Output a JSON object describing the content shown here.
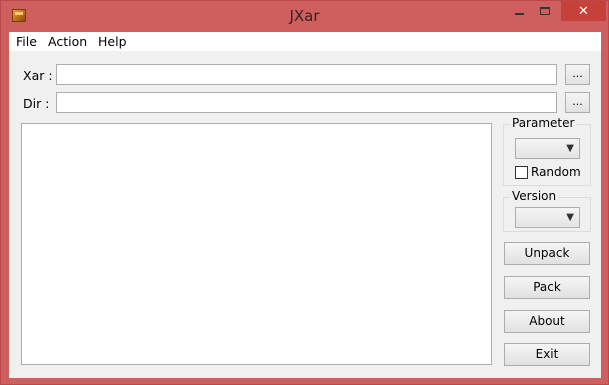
{
  "window": {
    "title": "JXar",
    "close_glyph": "✕"
  },
  "menu": {
    "file": "File",
    "action": "Action",
    "help": "Help"
  },
  "fields": {
    "xar_label": "Xar :",
    "dir_label": "Dir  :",
    "xar_value": "",
    "dir_value": "",
    "browse_label": "..."
  },
  "parameter": {
    "title": "Parameter",
    "selected": "",
    "random_label": "Random",
    "random_checked": false
  },
  "version": {
    "title": "Version",
    "selected": ""
  },
  "buttons": {
    "unpack": "Unpack",
    "pack": "Pack",
    "about": "About",
    "exit": "Exit"
  },
  "log": {
    "text": ""
  },
  "icons": {
    "app": "jxar-app-icon",
    "dropdown": "chevron-down-icon"
  },
  "colors": {
    "frame": "#cf5f5f",
    "close_button": "#c7403a",
    "client": "#f0f0f0"
  }
}
